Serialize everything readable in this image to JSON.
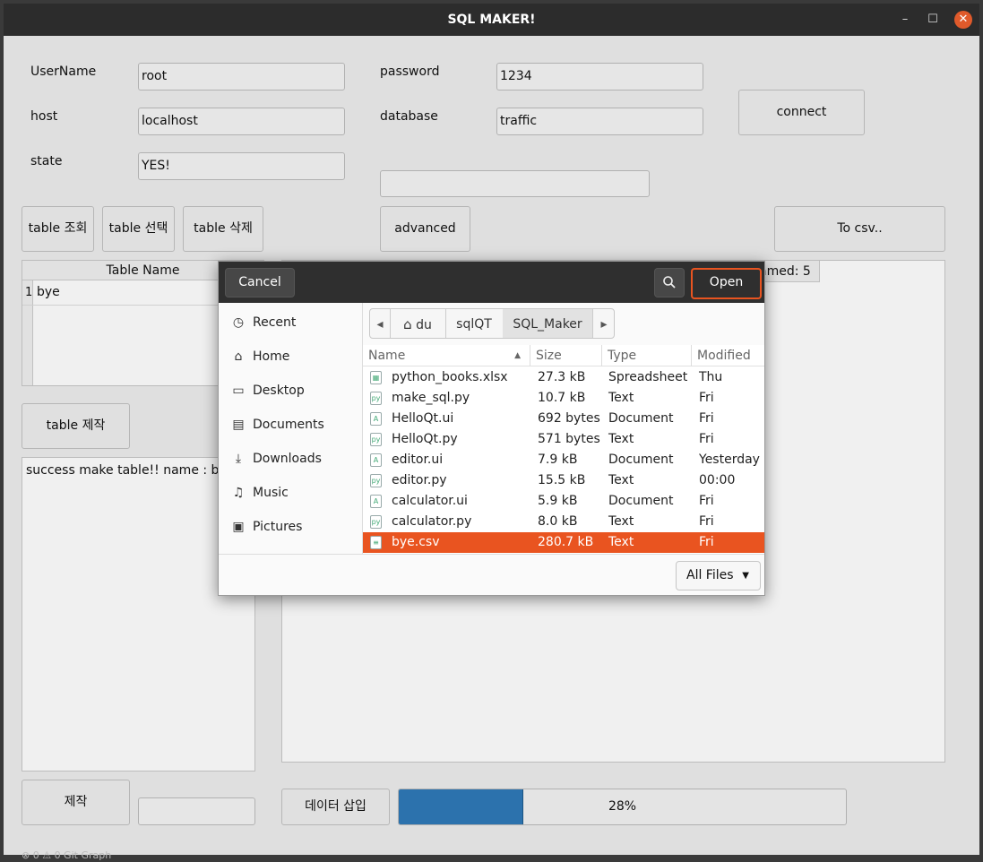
{
  "window": {
    "title": "SQL MAKER!",
    "minimize": "–",
    "maximize": "☐",
    "close": "✕"
  },
  "form": {
    "username_label": "UserName",
    "username_value": "root",
    "host_label": "host",
    "host_value": "localhost",
    "state_label": "state",
    "state_value": "YES!",
    "password_label": "password",
    "password_value": "1234",
    "database_label": "database",
    "database_value": "traffic",
    "extra_value": ""
  },
  "buttons": {
    "connect": "connect",
    "table_query": "table 조회",
    "table_select": "table 선택",
    "table_delete": "table 삭제",
    "advanced": "advanced",
    "to_csv": "To csv..",
    "table_make": "table 제작",
    "make": "제작",
    "insert_data": "데이터 삽입"
  },
  "table_list": {
    "header": "Table Name",
    "rows": [
      {
        "num": "1",
        "name": "bye"
      }
    ]
  },
  "log_text": "success make table!! name : bye",
  "make_input": "",
  "right_header_tail": "amed: 5",
  "progress": {
    "value": 28,
    "text": "28%",
    "color": "#2f7ab8"
  },
  "statusbar": {
    "text": "⊗ 0 ⚠ 0   Git Graph"
  },
  "dialog": {
    "cancel": "Cancel",
    "open": "Open",
    "search_icon": "search-icon",
    "places": [
      "Recent",
      "Home",
      "Desktop",
      "Documents",
      "Downloads",
      "Music",
      "Pictures"
    ],
    "place_icons": [
      "◷",
      "⌂",
      "▭",
      "▤",
      "⤓",
      "♫",
      "▣"
    ],
    "breadcrumbs": [
      "du",
      "sqlQT",
      "SQL_Maker"
    ],
    "columns": [
      "Name",
      "Size",
      "Type",
      "Modified"
    ],
    "files": [
      {
        "name": "python_books.xlsx",
        "size": "27.3 kB",
        "type": "Spreadsheet",
        "modified": "Thu",
        "icon": "▦"
      },
      {
        "name": "make_sql.py",
        "size": "10.7 kB",
        "type": "Text",
        "modified": "Fri",
        "icon": "py"
      },
      {
        "name": "HelloQt.ui",
        "size": "692 bytes",
        "type": "Document",
        "modified": "Fri",
        "icon": "A"
      },
      {
        "name": "HelloQt.py",
        "size": "571 bytes",
        "type": "Text",
        "modified": "Fri",
        "icon": "py"
      },
      {
        "name": "editor.ui",
        "size": "7.9 kB",
        "type": "Document",
        "modified": "Yesterday",
        "icon": "A"
      },
      {
        "name": "editor.py",
        "size": "15.5 kB",
        "type": "Text",
        "modified": "00:00",
        "icon": "py"
      },
      {
        "name": "calculator.ui",
        "size": "5.9 kB",
        "type": "Document",
        "modified": "Fri",
        "icon": "A"
      },
      {
        "name": "calculator.py",
        "size": "8.0 kB",
        "type": "Text",
        "modified": "Fri",
        "icon": "py"
      },
      {
        "name": "bye.csv",
        "size": "280.7 kB",
        "type": "Text",
        "modified": "Fri",
        "icon": "≡"
      }
    ],
    "selected_index": 8,
    "filter": "All Files",
    "accent": "#e95420"
  }
}
